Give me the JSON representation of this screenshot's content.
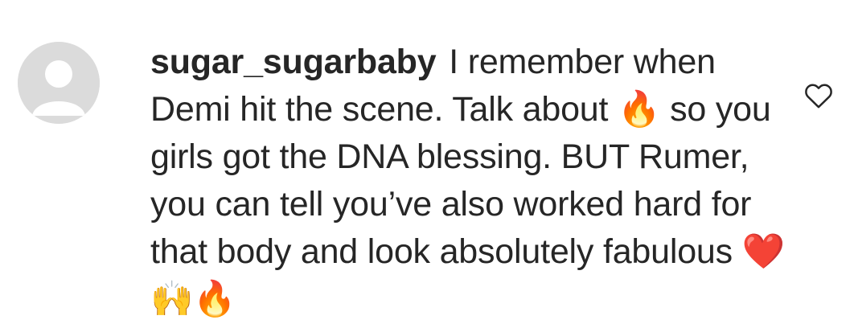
{
  "comment": {
    "username": "sugar_sugarbaby",
    "text_before_emoji": "I remember when Demi hit the scene. Talk about ",
    "emoji_fire": "🔥",
    "text_after_emoji": " so you girls got the DNA blessing. BUT Rumer, you can tell you’ve also worked hard for that body and look absolutely fabulous ",
    "emoji_trailing": "❤️🙌🔥"
  },
  "icons": {
    "avatar": "default-user-avatar-icon",
    "like": "heart-outline-icon"
  },
  "colors": {
    "text": "#262626",
    "avatar_bg": "#dbdbdb",
    "avatar_fg": "#ffffff"
  }
}
